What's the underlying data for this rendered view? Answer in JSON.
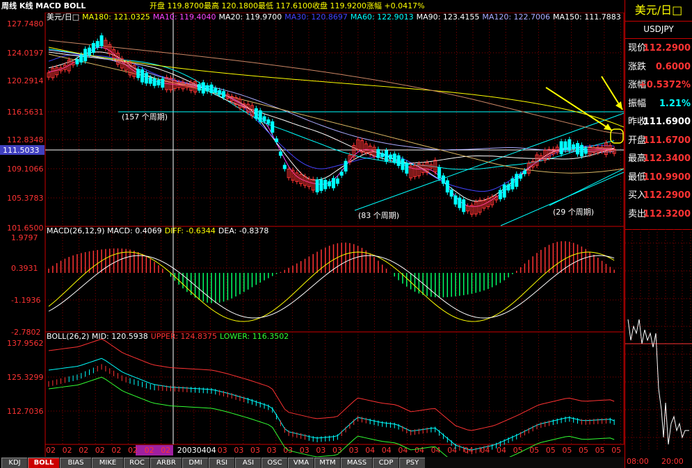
{
  "header": {
    "mode": "周线 K线 MACD BOLL",
    "ohlc": "开盘 119.8700最高 120.1800最低 117.6100收盘 119.9200涨幅 +0.0417%"
  },
  "ma_legend": [
    {
      "text": "美元/日□",
      "color": "#ffffff"
    },
    {
      "text": "MA180: 121.0325",
      "color": "#ffff00"
    },
    {
      "text": "MA10: 119.4040",
      "color": "#ff44ff"
    },
    {
      "text": "MA20: 119.9700",
      "color": "#ffffff"
    },
    {
      "text": "MA30: 120.8697",
      "color": "#4444ff"
    },
    {
      "text": "MA60: 122.9013",
      "color": "#00ffff"
    },
    {
      "text": "MA90: 123.4155",
      "color": "#ffffff"
    },
    {
      "text": "MA120: 122.7006",
      "color": "#aaaaff"
    },
    {
      "text": "MA150: 111.7883",
      "color": "#ffffff"
    }
  ],
  "price_axis": [
    "127.7480",
    "124.0197",
    "120.2914",
    "116.5631",
    "112.8348",
    "111.5033",
    "109.1066",
    "105.3783",
    "101.6500"
  ],
  "macd_legend": [
    {
      "text": "MACD(26,12,9) MACD: 0.4069",
      "color": "#ffffff"
    },
    {
      "text": "DIFF: -0.6344",
      "color": "#ffff00"
    },
    {
      "text": "DEA: -0.8378",
      "color": "#ffffff"
    }
  ],
  "macd_axis": [
    "1.9797",
    "0.3931",
    "-1.1936",
    "-2.7802"
  ],
  "boll_legend": [
    {
      "text": "BOLL(26,2) MID: 120.5938",
      "color": "#ffffff"
    },
    {
      "text": "UPPER: 124.8375",
      "color": "#ff3333"
    },
    {
      "text": "LOWER: 116.3502",
      "color": "#33ff33"
    }
  ],
  "boll_axis": [
    "137.9562",
    "125.3299",
    "112.7036"
  ],
  "annotations": {
    "a1": "(157 个周期)",
    "a2": "(83 个周期)",
    "a3": "(29 个周期)"
  },
  "date_axis": [
    "02",
    "02",
    "02",
    "02",
    "02",
    "02",
    "02",
    "02",
    "20030404",
    "03",
    "03",
    "03",
    "03",
    "03",
    "03",
    "03",
    "03",
    "03",
    "04",
    "04",
    "04",
    "04",
    "04",
    "04",
    "04",
    "04",
    "04",
    "05",
    "05",
    "05",
    "05",
    "05",
    "05",
    "05",
    "05"
  ],
  "tabs": [
    "KDJ",
    "BOLL",
    "BIAS",
    "MIKE",
    "ROC",
    "ARBR",
    "DMI",
    "RSI",
    "ASI",
    "OSC",
    "VMA",
    "MTM",
    "MASS",
    "CDP",
    "PSY"
  ],
  "active_tab": "BOLL",
  "quote": {
    "title": "美元/日□",
    "symbol": "USDJPY",
    "rows": [
      {
        "label": "现价",
        "value": "112.2900",
        "color": "#ff3333"
      },
      {
        "label": "涨跌",
        "value": "0.6000",
        "color": "#ff3333"
      },
      {
        "label": "涨幅",
        "value": "+0.5372%",
        "color": "#ff3333"
      },
      {
        "label": "振幅",
        "value": "1.21%",
        "color": "#00ffff"
      },
      {
        "label": "昨收",
        "value": "111.6900",
        "color": "#ffffff"
      },
      {
        "label": "开盘",
        "value": "111.6700",
        "color": "#ff3333"
      },
      {
        "label": "最高",
        "value": "112.3400",
        "color": "#ff3333"
      },
      {
        "label": "最低",
        "value": "110.9900",
        "color": "#ff3333"
      },
      {
        "label": "买入",
        "value": "112.2900",
        "color": "#ff3333"
      },
      {
        "label": "卖出",
        "value": "112.3200",
        "color": "#ff3333"
      }
    ]
  },
  "mini_time": [
    "08:00",
    "20:00"
  ]
}
